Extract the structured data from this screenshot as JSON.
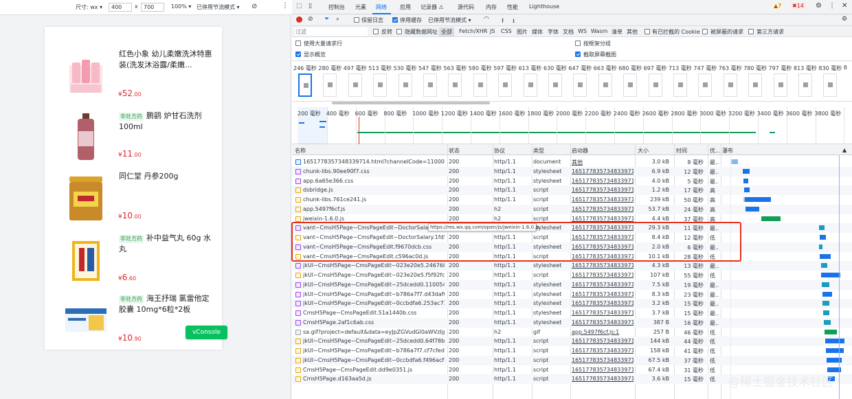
{
  "device_toolbar": {
    "dimensions_label": "尺寸: wx ▾",
    "width": "400",
    "times": "x",
    "height": "700",
    "zoom": "100% ▾",
    "throttle": "已停用节流模式 ▾"
  },
  "products": [
    {
      "tag": "",
      "name": "红色小象 幼儿柔嫩洗沐特惠装(洗发沐浴露/柔嫩...",
      "currency": "¥",
      "price_int": "52",
      "price_dec": ".00"
    },
    {
      "tag": "非处方药",
      "name": "鹏鹞 炉甘石洗剂 100ml",
      "currency": "¥",
      "price_int": "11",
      "price_dec": ".00"
    },
    {
      "tag": "",
      "name": "同仁堂 丹参200g",
      "currency": "¥",
      "price_int": "10",
      "price_dec": ".00"
    },
    {
      "tag": "非处方药",
      "name": "补中益气丸 60g 水丸",
      "currency": "¥",
      "price_int": "6",
      "price_dec": ".60"
    },
    {
      "tag": "非处方药",
      "name": "海王抒瑞 氯雷他定胶囊 10mg*6粒*2板",
      "currency": "¥",
      "price_int": "10",
      "price_dec": ".90"
    }
  ],
  "vconsole_label": "vConsole",
  "devtools_tabs": [
    "控制台",
    "元素",
    "网络",
    "应用",
    "记录器 ⚠",
    "源代码",
    "内存",
    "性能",
    "Lighthouse"
  ],
  "badges": {
    "warnings": "▲7",
    "errors": "✖14"
  },
  "toolbar1": {
    "preserve_log": "保留日志",
    "disable_cache": "停用缓存",
    "throttle": "已停用节流模式 ▾"
  },
  "toolbar2": {
    "filter_placeholder": "过滤",
    "invert": "反转",
    "hide_data_urls": "隐藏数据网址",
    "types": [
      "全部",
      "Fetch/XHR",
      "JS",
      "CSS",
      "图片",
      "媒体",
      "字体",
      "文档",
      "WS",
      "Wasm",
      "清单",
      "其他"
    ],
    "blocked_cookies": "有已拦截的 Cookie",
    "blocked_requests": "被屏蔽的请求",
    "third_party": "第三方请求"
  },
  "options": {
    "large_rows": "使用大量请求行",
    "show_overview": "显示概览",
    "group_by_frame": "按框架分组",
    "capture_screenshots": "截取屏幕截图"
  },
  "filmstrip_times": [
    "246 毫秒",
    "280 毫秒",
    "497 毫秒",
    "513 毫秒",
    "530 毫秒",
    "547 毫秒",
    "563 毫秒",
    "580 毫秒",
    "597 毫秒",
    "613 毫秒",
    "630 毫秒",
    "647 毫秒",
    "663 毫秒",
    "680 毫秒",
    "697 毫秒",
    "713 毫秒",
    "747 毫秒",
    "763 毫秒",
    "780 毫秒",
    "797 毫秒",
    "813 毫秒",
    "830 毫秒",
    "8"
  ],
  "overview_ticks": [
    "200 毫秒",
    "400 毫秒",
    "600 毫秒",
    "800 毫秒",
    "1000 毫秒",
    "1200 毫秒",
    "1400 毫秒",
    "1600 毫秒",
    "1800 毫秒",
    "2000 毫秒",
    "2200 毫秒",
    "2400 毫秒",
    "2600 毫秒",
    "2800 毫秒",
    "3000 毫秒",
    "3200 毫秒",
    "3400 毫秒",
    "3600 毫秒",
    "3800 毫秒"
  ],
  "table_headers": {
    "name": "名称",
    "status": "状态",
    "protocol": "协议",
    "type": "类型",
    "initiator": "启动器",
    "size": "大小",
    "time": "时间",
    "priority": "优...",
    "waterfall": "瀑布"
  },
  "requests": [
    {
      "icon": "doc",
      "name": "1651778357348339714.html?channelCode=110001&a...",
      "status": "200",
      "protocol": "http/1.1",
      "type": "document",
      "initiator": "其他",
      "size": "3.0 kB",
      "time": "8 毫秒",
      "priority": "最..."
    },
    {
      "icon": "css",
      "name": "chunk-libs.90ee90f7.css",
      "status": "200",
      "protocol": "http/1.1",
      "type": "stylesheet",
      "initiator": "165177835734833971...",
      "size": "6.9 kB",
      "time": "12 毫秒",
      "priority": "最..."
    },
    {
      "icon": "css",
      "name": "app.6a65e366.css",
      "status": "200",
      "protocol": "http/1.1",
      "type": "stylesheet",
      "initiator": "165177835734833971...",
      "size": "4.0 kB",
      "time": "5 毫秒",
      "priority": "最..."
    },
    {
      "icon": "js",
      "name": "dsbridge.js",
      "status": "200",
      "protocol": "http/1.1",
      "type": "script",
      "initiator": "165177835734833971...",
      "size": "1.2 kB",
      "time": "17 毫秒",
      "priority": "高"
    },
    {
      "icon": "js",
      "name": "chunk-libs.761ce241.js",
      "status": "200",
      "protocol": "http/1.1",
      "type": "script",
      "initiator": "165177835734833971...",
      "size": "239 kB",
      "time": "50 毫秒",
      "priority": "高"
    },
    {
      "icon": "js",
      "name": "app.5497f6cf.js",
      "status": "200",
      "protocol": "h2",
      "type": "script",
      "initiator": "165177835734833971...",
      "size": "53.7 kB",
      "time": "24 毫秒",
      "priority": "高"
    },
    {
      "icon": "js",
      "name": "jweixin-1.6.0.js",
      "status": "200",
      "protocol": "h2",
      "type": "script",
      "initiator": "165177835734833971...",
      "size": "4.4 kB",
      "time": "37 毫秒",
      "priority": "高"
    },
    {
      "icon": "css",
      "name": "vant~CmsH5Page~CmsPageEdit~DoctorSalary.a1",
      "status": "200",
      "protocol": "http/1.1",
      "type": "stylesheet",
      "initiator": "165177835734833971...",
      "size": "29.3 kB",
      "time": "11 毫秒",
      "priority": "最..."
    },
    {
      "icon": "js",
      "name": "vant~CmsH5Page~CmsPageEdit~DoctorSalary.1fd521...",
      "status": "200",
      "protocol": "http/1.1",
      "type": "script",
      "initiator": "165177835734833971...",
      "size": "8.4 kB",
      "time": "12 毫秒",
      "priority": "低"
    },
    {
      "icon": "css",
      "name": "vant~CmsH5Page~CmsPageEdit.f9670dcb.css",
      "status": "200",
      "protocol": "http/1.1",
      "type": "stylesheet",
      "initiator": "165177835734833971...",
      "size": "2.0 kB",
      "time": "6 毫秒",
      "priority": "最..."
    },
    {
      "icon": "js",
      "name": "vant~CmsH5Page~CmsPageEdit.c596ac0d.js",
      "status": "200",
      "protocol": "http/1.1",
      "type": "script",
      "initiator": "165177835734833971...",
      "size": "10.1 kB",
      "time": "28 毫秒",
      "priority": "低"
    },
    {
      "icon": "css",
      "name": "jkUI~CmsH5Page~CmsPageEdit~023e20e5.246760cc....",
      "status": "200",
      "protocol": "http/1.1",
      "type": "stylesheet",
      "initiator": "165177835734833971...",
      "size": "4.3 kB",
      "time": "13 毫秒",
      "priority": "最..."
    },
    {
      "icon": "js",
      "name": "jkUI~CmsH5Page~CmsPageEdit~023e20e5.f5f92fc6.js",
      "status": "200",
      "protocol": "http/1.1",
      "type": "script",
      "initiator": "165177835734833971...",
      "size": "107 kB",
      "time": "55 毫秒",
      "priority": "低"
    },
    {
      "icon": "css",
      "name": "jkUI~CmsH5Page~CmsPageEdit~25dcedd0.110054cd....",
      "status": "200",
      "protocol": "http/1.1",
      "type": "stylesheet",
      "initiator": "165177835734833971...",
      "size": "7.5 kB",
      "time": "19 毫秒",
      "priority": "最..."
    },
    {
      "icon": "css",
      "name": "jkUI~CmsH5Page~CmsPageEdit~b786a7f7.d43daf0a.css",
      "status": "200",
      "protocol": "http/1.1",
      "type": "stylesheet",
      "initiator": "165177835734833971...",
      "size": "8.3 kB",
      "time": "23 毫秒",
      "priority": "最..."
    },
    {
      "icon": "css",
      "name": "jkUI~CmsH5Page~CmsPageEdit~0ccbdfa6.253ac736....",
      "status": "200",
      "protocol": "http/1.1",
      "type": "stylesheet",
      "initiator": "165177835734833971...",
      "size": "3.2 kB",
      "time": "15 毫秒",
      "priority": "最..."
    },
    {
      "icon": "css",
      "name": "CmsH5Page~CmsPageEdit.51a1440b.css",
      "status": "200",
      "protocol": "http/1.1",
      "type": "stylesheet",
      "initiator": "165177835734833971...",
      "size": "3.7 kB",
      "time": "15 毫秒",
      "priority": "最..."
    },
    {
      "icon": "css",
      "name": "CmsH5Page.2af1c6ab.css",
      "status": "200",
      "protocol": "http/1.1",
      "type": "stylesheet",
      "initiator": "165177835734833971...",
      "size": "387 B",
      "time": "16 毫秒",
      "priority": "最..."
    },
    {
      "icon": "gif",
      "name": "sa.gif?project=default&data=eyJpZGVudGl0aWVzIjp7Ii...",
      "status": "200",
      "protocol": "h2",
      "type": "gif",
      "initiator": "app.5497f6cf.js:1",
      "size": "257 B",
      "time": "46 毫秒",
      "priority": "低"
    },
    {
      "icon": "js",
      "name": "jkUI~CmsH5Page~CmsPageEdit~25dcedd0.64f78b16.js",
      "status": "200",
      "protocol": "http/1.1",
      "type": "script",
      "initiator": "165177835734833971...",
      "size": "144 kB",
      "time": "44 毫秒",
      "priority": "低"
    },
    {
      "icon": "js",
      "name": "jkUI~CmsH5Page~CmsPageEdit~b786a7f7.cf7cfedc.js",
      "status": "200",
      "protocol": "http/1.1",
      "type": "script",
      "initiator": "165177835734833971...",
      "size": "158 kB",
      "time": "41 毫秒",
      "priority": "低"
    },
    {
      "icon": "js",
      "name": "jkUI~CmsH5Page~CmsPageEdit~0ccbdfa6.f496acf0.js",
      "status": "200",
      "protocol": "http/1.1",
      "type": "script",
      "initiator": "165177835734833971...",
      "size": "67.5 kB",
      "time": "37 毫秒",
      "priority": "低"
    },
    {
      "icon": "js",
      "name": "CmsH5Page~CmsPageEdit.dd9e0351.js",
      "status": "200",
      "protocol": "http/1.1",
      "type": "script",
      "initiator": "165177835734833971...",
      "size": "67.4 kB",
      "time": "31 毫秒",
      "priority": "低"
    },
    {
      "icon": "js",
      "name": "CmsH5Page.d163aa5d.js",
      "status": "200",
      "protocol": "http/1.1",
      "type": "script",
      "initiator": "165177835734833971...",
      "size": "3.6 kB",
      "time": "15 毫秒",
      "priority": "低"
    }
  ],
  "tooltip_url": "https://res.wx.qq.com/open/js/jweixin-1.6.0.js",
  "watermark": "@稀土掘金技术社区",
  "colors": {
    "accent": "#1a73e8",
    "highlight": "#e8311d",
    "price": "#e0282e",
    "vconsole": "#07c160",
    "otc_tag": "#2e9b4a"
  }
}
